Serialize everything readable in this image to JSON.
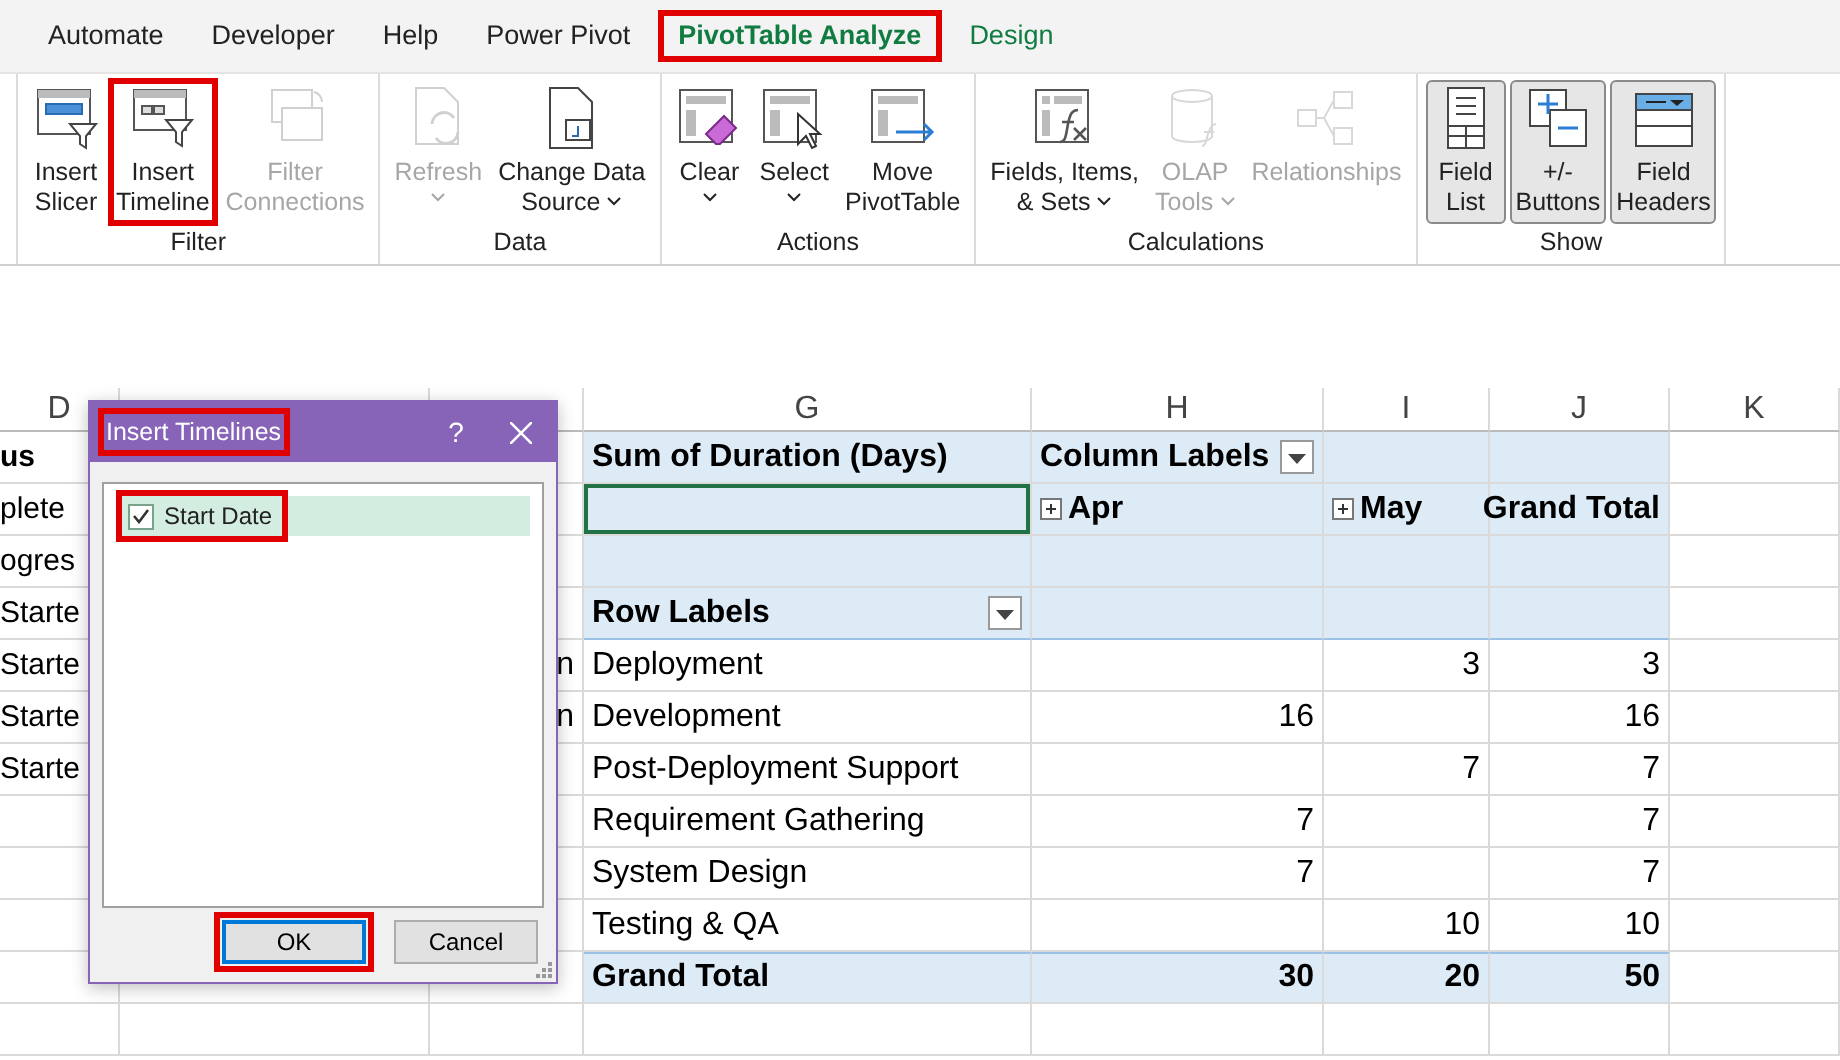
{
  "ribbon": {
    "tabs": [
      {
        "label": "Automate",
        "selected": false,
        "contextual": false,
        "highlighted": false
      },
      {
        "label": "Developer",
        "selected": false,
        "contextual": false,
        "highlighted": false
      },
      {
        "label": "Help",
        "selected": false,
        "contextual": false,
        "highlighted": false
      },
      {
        "label": "Power Pivot",
        "selected": false,
        "contextual": false,
        "highlighted": false
      },
      {
        "label": "PivotTable Analyze",
        "selected": true,
        "contextual": true,
        "highlighted": true
      },
      {
        "label": "Design",
        "selected": false,
        "contextual": true,
        "highlighted": false
      }
    ],
    "groups": [
      {
        "label": "Filter",
        "buttons": [
          {
            "label": "Insert\nSlicer",
            "disabled": false,
            "has_menu": false,
            "on": false,
            "highlighted": false
          },
          {
            "label": "Insert\nTimeline",
            "disabled": false,
            "has_menu": false,
            "on": false,
            "highlighted": true
          },
          {
            "label": "Filter\nConnections",
            "disabled": true,
            "has_menu": false,
            "on": false,
            "highlighted": false
          }
        ]
      },
      {
        "label": "Data",
        "buttons": [
          {
            "label": "Refresh",
            "disabled": true,
            "has_menu": true,
            "on": false,
            "highlighted": false
          },
          {
            "label": "Change Data\nSource",
            "disabled": false,
            "has_menu": true,
            "on": false,
            "highlighted": false
          }
        ]
      },
      {
        "label": "Actions",
        "buttons": [
          {
            "label": "Clear",
            "disabled": false,
            "has_menu": true,
            "on": false,
            "highlighted": false
          },
          {
            "label": "Select",
            "disabled": false,
            "has_menu": true,
            "on": false,
            "highlighted": false
          },
          {
            "label": "Move\nPivotTable",
            "disabled": false,
            "has_menu": false,
            "on": false,
            "highlighted": false
          }
        ]
      },
      {
        "label": "Calculations",
        "buttons": [
          {
            "label": "Fields, Items,\n& Sets",
            "disabled": false,
            "has_menu": true,
            "on": false,
            "highlighted": false
          },
          {
            "label": "OLAP\nTools",
            "disabled": true,
            "has_menu": true,
            "on": false,
            "highlighted": false
          },
          {
            "label": "Relationships",
            "disabled": true,
            "has_menu": false,
            "on": false,
            "highlighted": false
          }
        ]
      },
      {
        "label": "Show",
        "buttons": [
          {
            "label": "Field\nList",
            "disabled": false,
            "has_menu": false,
            "on": true,
            "highlighted": false
          },
          {
            "label": "+/-\nButtons",
            "disabled": false,
            "has_menu": false,
            "on": true,
            "highlighted": false
          },
          {
            "label": "Field\nHeaders",
            "disabled": false,
            "has_menu": false,
            "on": true,
            "highlighted": false
          }
        ]
      }
    ]
  },
  "sheet": {
    "column_headers": [
      "D",
      "G",
      "H",
      "I",
      "J",
      "K"
    ],
    "rows": [
      {
        "column_d": "us",
        "bold": true
      },
      {
        "column_d": "plete",
        "bold": false
      },
      {
        "column_d": "ogres",
        "bold": false
      },
      {
        "column_d": "Starte",
        "bold": false
      },
      {
        "column_d": "Starte",
        "bold": false,
        "column_f": "n"
      },
      {
        "column_d": "Starte",
        "bold": false,
        "column_f": "n"
      },
      {
        "column_d": "Starte",
        "bold": false
      }
    ]
  },
  "pivot": {
    "value_field": "Sum of Duration (Days)",
    "column_labels": "Column Labels",
    "blank_cell_selected": true,
    "columns": [
      {
        "label": "Apr",
        "expandable": true
      },
      {
        "label": "May",
        "expandable": true
      }
    ],
    "grand_total_header": "Grand Total",
    "row_labels": "Row Labels",
    "rows": [
      {
        "label": "Deployment",
        "may": "3",
        "total": "3"
      },
      {
        "label": "Development",
        "apr": "16",
        "total": "16"
      },
      {
        "label": "Post-Deployment Support",
        "may": "7",
        "total": "7"
      },
      {
        "label": "Requirement Gathering",
        "apr": "7",
        "total": "7"
      },
      {
        "label": "System Design",
        "apr": "7",
        "total": "7"
      },
      {
        "label": "Testing & QA",
        "may": "10",
        "total": "10"
      }
    ],
    "grand_total": {
      "label": "Grand Total",
      "apr": "30",
      "may": "20",
      "total": "50"
    }
  },
  "dialog": {
    "title": "Insert Timelines",
    "title_highlighted": true,
    "help": "?",
    "fields": [
      {
        "label": "Start Date",
        "checked": true,
        "selected": true,
        "highlighted": true
      }
    ],
    "buttons": [
      {
        "label": "OK",
        "default": true,
        "highlighted": true
      },
      {
        "label": "Cancel",
        "default": false,
        "highlighted": false
      }
    ]
  }
}
